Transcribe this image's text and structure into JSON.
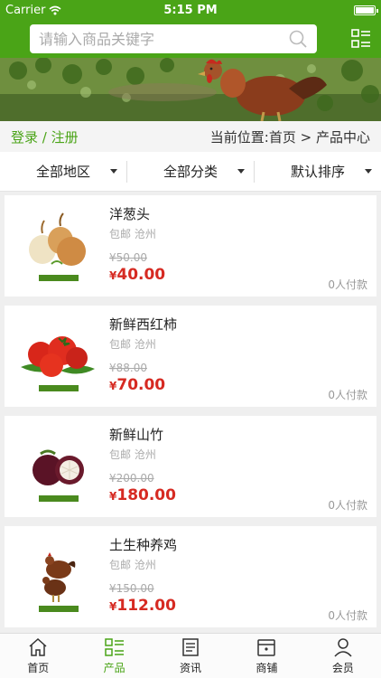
{
  "status": {
    "carrier": "Carrier",
    "time": "5:15 PM"
  },
  "search": {
    "placeholder": "请输入商品关键字",
    "value": ""
  },
  "account": {
    "login": "登录",
    "separator": " / ",
    "register": "注册"
  },
  "breadcrumb": {
    "prefix": "当前位置:",
    "home": "首页",
    "arrow": " > ",
    "current": "产品中心"
  },
  "filters": [
    {
      "label": "全部地区"
    },
    {
      "label": "全部分类"
    },
    {
      "label": "默认排序"
    }
  ],
  "products": [
    {
      "name": "洋葱头",
      "shipping": "包邮",
      "city": "沧州",
      "old_price": "¥50.00",
      "currency": "¥",
      "price": "40.00",
      "paid": "0人付款",
      "image": "onion"
    },
    {
      "name": "新鲜西红柿",
      "shipping": "包邮",
      "city": "沧州",
      "old_price": "¥88.00",
      "currency": "¥",
      "price": "70.00",
      "paid": "0人付款",
      "image": "tomato"
    },
    {
      "name": "新鲜山竹",
      "shipping": "包邮",
      "city": "沧州",
      "old_price": "¥200.00",
      "currency": "¥",
      "price": "180.00",
      "paid": "0人付款",
      "image": "mangosteen"
    },
    {
      "name": "土生种养鸡",
      "shipping": "包邮",
      "city": "沧州",
      "old_price": "¥150.00",
      "currency": "¥",
      "price": "112.00",
      "paid": "0人付款",
      "image": "chicken"
    }
  ],
  "tabs": [
    {
      "label": "首页",
      "icon": "home-icon",
      "active": false
    },
    {
      "label": "产品",
      "icon": "grid-list-icon",
      "active": true
    },
    {
      "label": "资讯",
      "icon": "news-icon",
      "active": false
    },
    {
      "label": "商铺",
      "icon": "shop-icon",
      "active": false
    },
    {
      "label": "会员",
      "icon": "user-icon",
      "active": false
    }
  ],
  "colors": {
    "brand": "#4aa417",
    "price": "#d62a22"
  }
}
